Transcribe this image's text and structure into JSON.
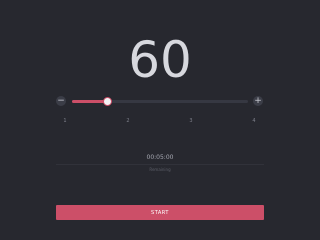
{
  "counter": {
    "value": "60"
  },
  "slider": {
    "minus_icon": "minus-icon",
    "plus_icon": "plus-icon",
    "level_fraction": 0.2,
    "ticks": [
      "1",
      "2",
      "3",
      "4"
    ],
    "accent_color": "#cc4f68"
  },
  "timer": {
    "display": "00:05:00",
    "subtext": "Remaining"
  },
  "start": {
    "label": "START"
  }
}
